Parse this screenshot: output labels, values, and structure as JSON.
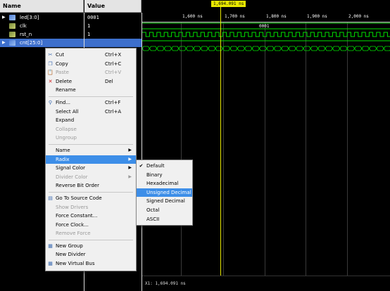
{
  "columns": {
    "name": "Name",
    "value": "Value"
  },
  "signals": [
    {
      "name": "led[3:0]",
      "value": "0001",
      "type": "bus",
      "expander": "▶"
    },
    {
      "name": "clk",
      "value": "1",
      "type": "bit",
      "expander": ""
    },
    {
      "name": "rst_n",
      "value": "1",
      "type": "bit",
      "expander": ""
    },
    {
      "name": "cnt[25:0]",
      "value": "",
      "type": "bus",
      "expander": "▶"
    }
  ],
  "timeline": {
    "ticks": [
      "1,600 ns",
      "1,700 ns",
      "1,800 ns",
      "1,900 ns",
      "2,000 ns"
    ],
    "cursor": "1,694.091 ns"
  },
  "waves": {
    "led_value": "0001",
    "cnt_label": "..."
  },
  "status": "X1: 1,694.091 ns",
  "context_menu": [
    {
      "label": "Cut",
      "shortcut": "Ctrl+X",
      "icon": "scissors-icon",
      "glyph": "✂",
      "disabled": false
    },
    {
      "label": "Copy",
      "shortcut": "Ctrl+C",
      "icon": "copy-icon",
      "glyph": "❐",
      "disabled": false
    },
    {
      "label": "Paste",
      "shortcut": "Ctrl+V",
      "icon": "paste-icon",
      "glyph": "📋",
      "disabled": true
    },
    {
      "label": "Delete",
      "shortcut": "Del",
      "icon": "delete-icon",
      "glyph": "✕",
      "disabled": false
    },
    {
      "label": "Rename",
      "shortcut": "",
      "icon": "",
      "glyph": "",
      "disabled": false
    },
    {
      "sep": true
    },
    {
      "label": "Find...",
      "shortcut": "Ctrl+F",
      "icon": "binoculars-icon",
      "glyph": "⚲",
      "disabled": false
    },
    {
      "label": "Select All",
      "shortcut": "Ctrl+A",
      "icon": "",
      "glyph": "",
      "disabled": false
    },
    {
      "label": "Expand",
      "shortcut": "",
      "icon": "",
      "glyph": "",
      "disabled": false
    },
    {
      "label": "Collapse",
      "shortcut": "",
      "icon": "",
      "glyph": "",
      "disabled": true
    },
    {
      "label": "Ungroup",
      "shortcut": "",
      "icon": "",
      "glyph": "",
      "disabled": true
    },
    {
      "sep": true
    },
    {
      "label": "Name",
      "shortcut": "",
      "icon": "",
      "glyph": "",
      "disabled": false,
      "submenu": true
    },
    {
      "label": "Radix",
      "shortcut": "",
      "icon": "",
      "glyph": "",
      "disabled": false,
      "submenu": true,
      "highlight": true
    },
    {
      "label": "Signal Color",
      "shortcut": "",
      "icon": "",
      "glyph": "",
      "disabled": false,
      "submenu": true
    },
    {
      "label": "Divider Color",
      "shortcut": "",
      "icon": "",
      "glyph": "",
      "disabled": true,
      "submenu": true
    },
    {
      "label": "Reverse Bit Order",
      "shortcut": "",
      "icon": "",
      "glyph": "",
      "disabled": false
    },
    {
      "sep": true
    },
    {
      "label": "Go To Source Code",
      "shortcut": "",
      "icon": "source-code-icon",
      "glyph": "▤",
      "disabled": false
    },
    {
      "label": "Show Drivers",
      "shortcut": "",
      "icon": "",
      "glyph": "",
      "disabled": true
    },
    {
      "label": "Force Constant...",
      "shortcut": "",
      "icon": "",
      "glyph": "",
      "disabled": false
    },
    {
      "label": "Force Clock...",
      "shortcut": "",
      "icon": "",
      "glyph": "",
      "disabled": false
    },
    {
      "label": "Remove Force",
      "shortcut": "",
      "icon": "",
      "glyph": "",
      "disabled": true
    },
    {
      "sep": true
    },
    {
      "label": "New Group",
      "shortcut": "",
      "icon": "group-icon",
      "glyph": "▦",
      "disabled": false
    },
    {
      "label": "New Divider",
      "shortcut": "",
      "icon": "",
      "glyph": "",
      "disabled": false
    },
    {
      "label": "New Virtual Bus",
      "shortcut": "",
      "icon": "virtual-bus-icon",
      "glyph": "▦",
      "disabled": false
    }
  ],
  "radix_menu": [
    {
      "label": "Default",
      "checked": true
    },
    {
      "label": "Binary",
      "checked": false
    },
    {
      "label": "Hexadecimal",
      "checked": false
    },
    {
      "label": "Unsigned Decimal",
      "checked": false,
      "highlight": true
    },
    {
      "label": "Signed Decimal",
      "checked": false
    },
    {
      "label": "Octal",
      "checked": false
    },
    {
      "label": "ASCII",
      "checked": false
    }
  ],
  "colors": {
    "bus_wave": "#00e000",
    "highlight": "#3d8ee8",
    "cursor": "#e8e800",
    "selected_row": "#3d6fcc"
  }
}
